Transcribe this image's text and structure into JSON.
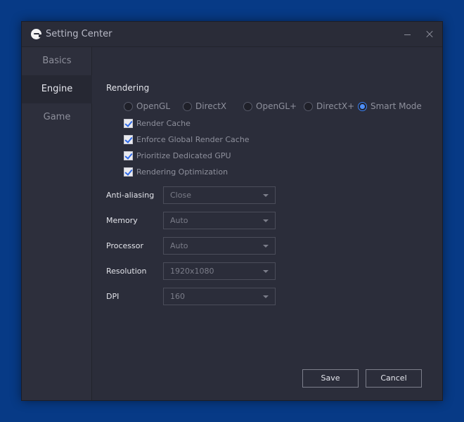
{
  "window": {
    "title": "Setting Center"
  },
  "sidebar": {
    "items": [
      {
        "label": "Basics"
      },
      {
        "label": "Engine"
      },
      {
        "label": "Game"
      }
    ],
    "active": "Engine"
  },
  "rendering": {
    "label": "Rendering",
    "modes": [
      "OpenGL",
      "DirectX",
      "OpenGL+",
      "DirectX+",
      "Smart Mode"
    ],
    "selected_mode": "Smart Mode",
    "options": [
      {
        "label": "Render Cache",
        "checked": true
      },
      {
        "label": "Enforce Global Render Cache",
        "checked": true
      },
      {
        "label": "Prioritize Dedicated GPU",
        "checked": true
      },
      {
        "label": "Rendering Optimization",
        "checked": true
      }
    ]
  },
  "fields": [
    {
      "label": "Anti-aliasing",
      "value": "Close"
    },
    {
      "label": "Memory",
      "value": "Auto"
    },
    {
      "label": "Processor",
      "value": "Auto"
    },
    {
      "label": "Resolution",
      "value": "1920x1080"
    },
    {
      "label": "DPI",
      "value": "160"
    }
  ],
  "actions": {
    "save_label": "Save",
    "cancel_label": "Cancel"
  },
  "colors": {
    "desktop": "#073a86",
    "window_bg": "#2b2d3a",
    "accent": "#3b82f6"
  }
}
